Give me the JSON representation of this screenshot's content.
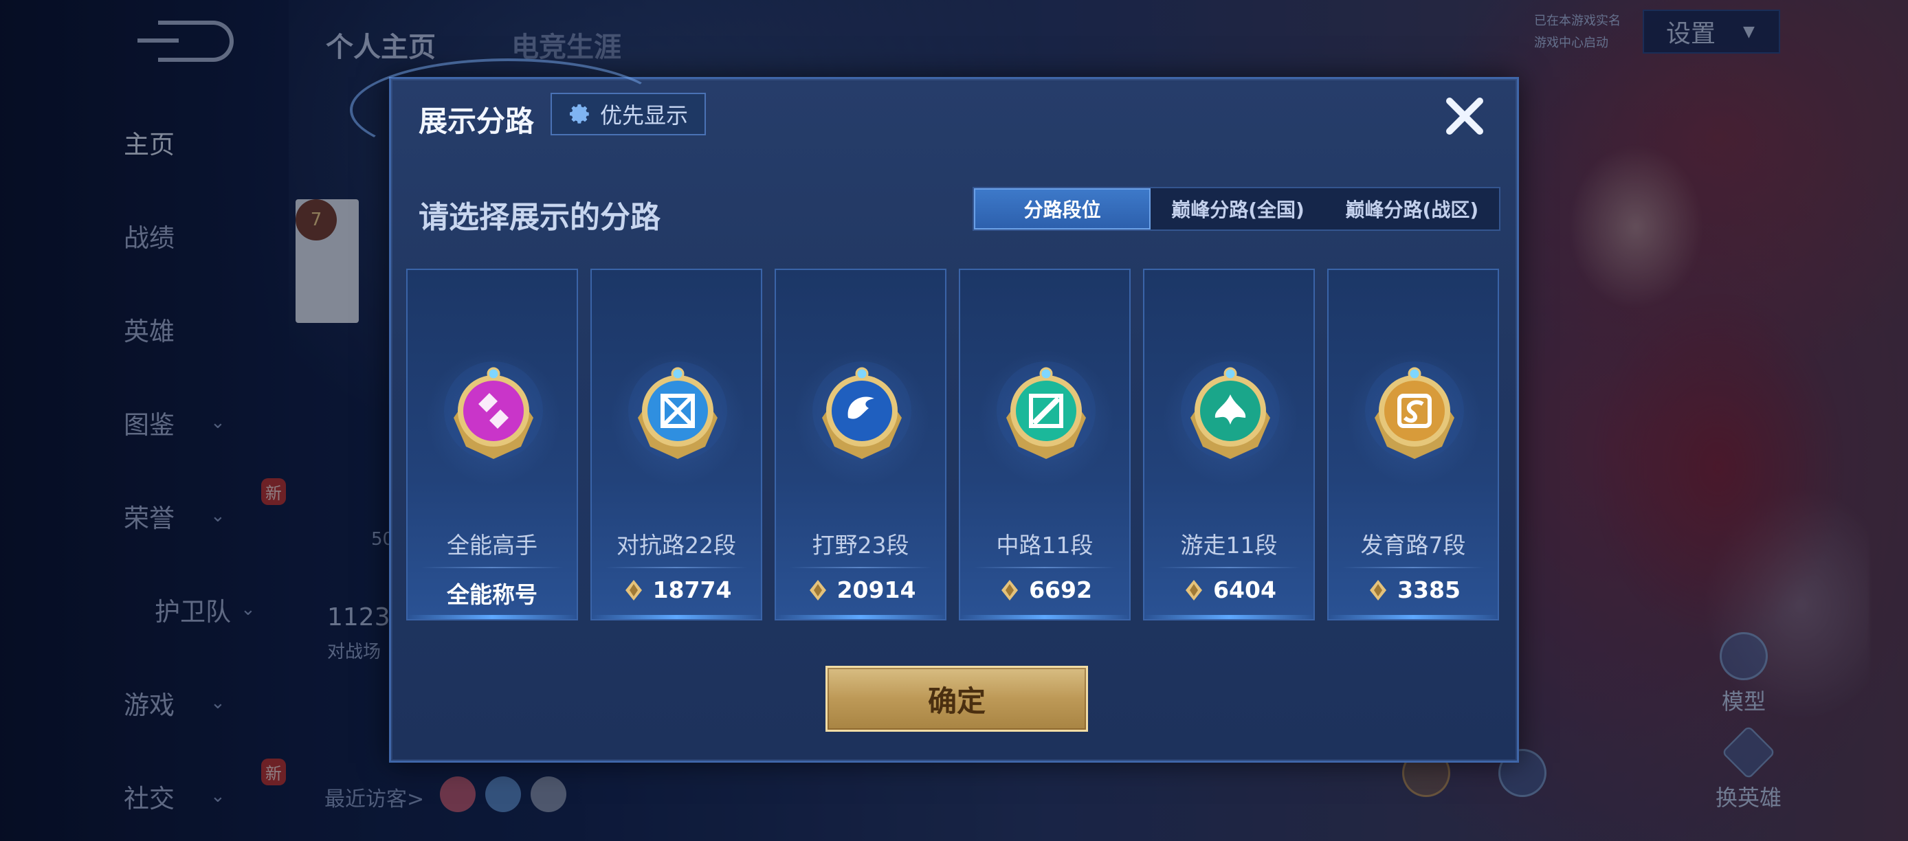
{
  "background": {
    "top_tabs": [
      "个人主页",
      "电竞生涯"
    ],
    "settings_label": "设置",
    "notes": [
      "已在本游戏实名",
      "游戏中心启动"
    ],
    "sidebar": [
      {
        "label": "主页",
        "active": true,
        "chevron": false,
        "new": false
      },
      {
        "label": "战绩",
        "active": false,
        "chevron": false,
        "new": false
      },
      {
        "label": "英雄",
        "active": false,
        "chevron": false,
        "new": false
      },
      {
        "label": "图鉴",
        "active": false,
        "chevron": true,
        "new": false
      },
      {
        "label": "荣誉",
        "active": false,
        "chevron": true,
        "new": true
      },
      {
        "label": "护卫队",
        "active": false,
        "chevron": true,
        "new": false
      },
      {
        "label": "游戏",
        "active": false,
        "chevron": true,
        "new": false
      },
      {
        "label": "社交",
        "active": false,
        "chevron": true,
        "new": true
      }
    ],
    "new_badge": "新",
    "profile_level": "7",
    "profile_number": "1123",
    "profile_sub": "对战场",
    "profile_num2": "50",
    "recent_visitors_label": "最近访客>",
    "right_actions": [
      "模型",
      "换英雄"
    ]
  },
  "dialog": {
    "title": "展示分路",
    "priority_label": "优先显示",
    "prompt": "请选择展示的分路",
    "tabs": [
      {
        "label": "分路段位",
        "active": true
      },
      {
        "label": "巅峰分路(全国)",
        "active": false
      },
      {
        "label": "巅峰分路(战区)",
        "active": false
      }
    ],
    "cards": [
      {
        "name": "全能高手",
        "value": "全能称号",
        "diamond": false,
        "emblem": "all-round",
        "color": "#c935c9"
      },
      {
        "name": "对抗路22段",
        "value": "18774",
        "diamond": true,
        "emblem": "clash-lane",
        "color": "#2f8fe0"
      },
      {
        "name": "打野23段",
        "value": "20914",
        "diamond": true,
        "emblem": "jungle",
        "color": "#1f5fbf"
      },
      {
        "name": "中路11段",
        "value": "6692",
        "diamond": true,
        "emblem": "mid-lane",
        "color": "#1bb89a"
      },
      {
        "name": "游走11段",
        "value": "6404",
        "diamond": true,
        "emblem": "roam",
        "color": "#1aa68a"
      },
      {
        "name": "发育路7段",
        "value": "3385",
        "diamond": true,
        "emblem": "farm-lane",
        "color": "#d89b3a"
      }
    ],
    "confirm_label": "确定"
  }
}
